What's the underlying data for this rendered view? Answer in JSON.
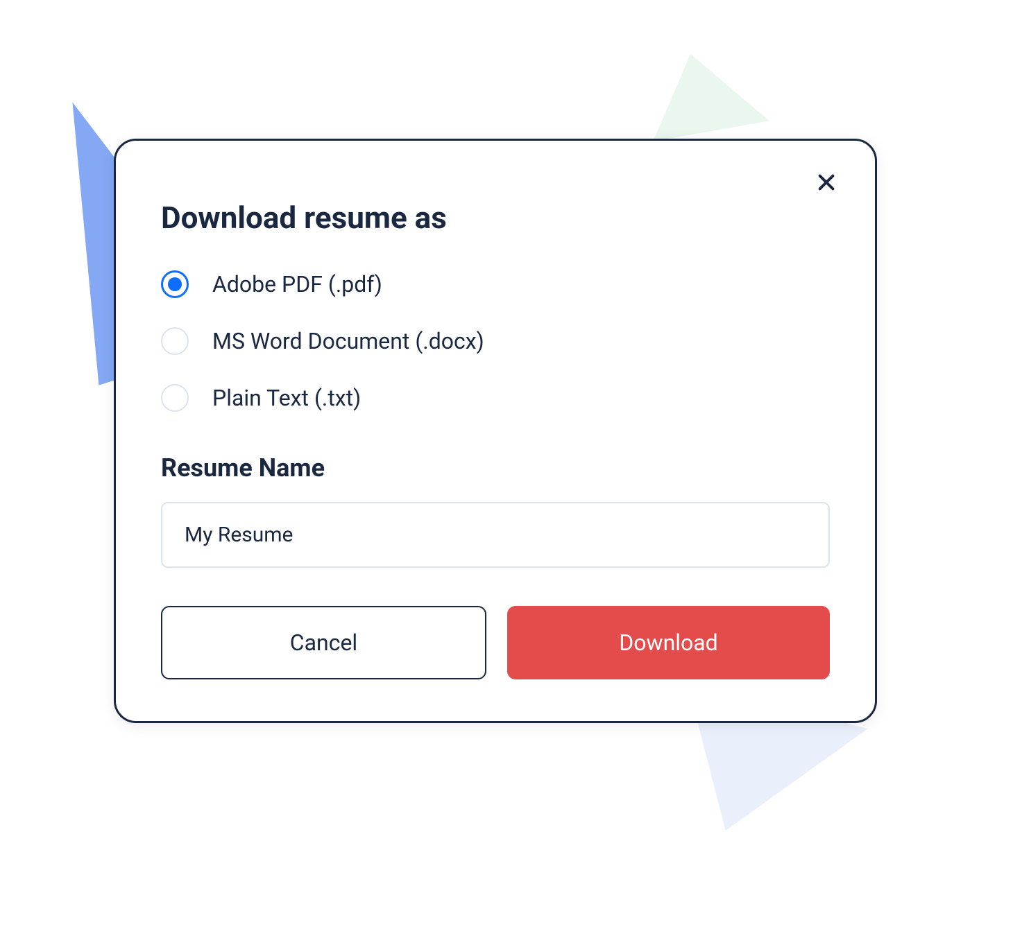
{
  "modal": {
    "title": "Download resume as",
    "formats": [
      {
        "label": "Adobe PDF (.pdf)",
        "selected": true
      },
      {
        "label": "MS Word Document  (.docx)",
        "selected": false
      },
      {
        "label": "Plain Text (.txt)",
        "selected": false
      }
    ],
    "resume_name_label": "Resume Name",
    "resume_name_value": "My Resume",
    "cancel_label": "Cancel",
    "download_label": "Download"
  }
}
